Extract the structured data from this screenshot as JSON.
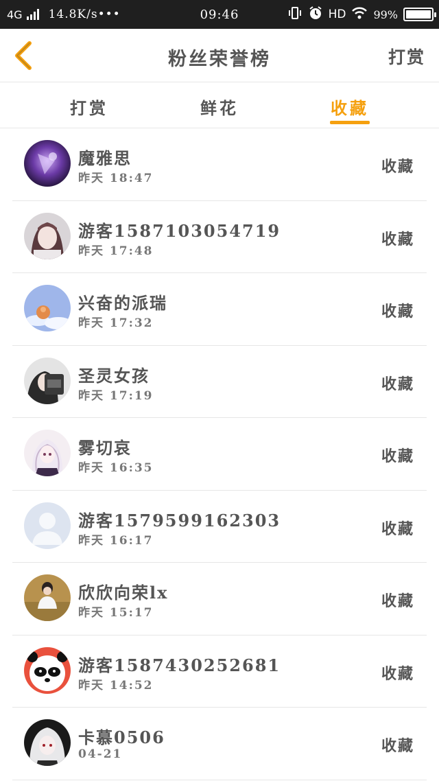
{
  "status_bar": {
    "network": "4G",
    "speed": "14.8K/s•••",
    "time": "09:46",
    "hd": "HD",
    "battery_percent": "99%",
    "battery_level": 0.99
  },
  "header": {
    "title": "粉丝荣誉榜",
    "action_label": "打赏",
    "back_icon": "chevron-left-icon"
  },
  "tabs": [
    {
      "label": "打赏",
      "active": false
    },
    {
      "label": "鲜花",
      "active": false
    },
    {
      "label": "收藏",
      "active": true
    }
  ],
  "colors": {
    "accent": "#f5a00f",
    "status_bar_bg": "#1f1f1f",
    "text": "#555555"
  },
  "fans": [
    {
      "name": "魔雅思",
      "time": "昨天 18:47",
      "action": "收藏",
      "avatar": "purple-anime-avatar"
    },
    {
      "name": "游客1587103054719",
      "time": "昨天 17:48",
      "action": "收藏",
      "avatar": "anime-girl-avatar"
    },
    {
      "name": "兴奋的派瑞",
      "time": "昨天 17:32",
      "action": "收藏",
      "avatar": "sky-avatar"
    },
    {
      "name": "圣灵女孩",
      "time": "昨天 17:19",
      "action": "收藏",
      "avatar": "photo-girl-avatar"
    },
    {
      "name": "雾切哀",
      "time": "昨天 16:35",
      "action": "收藏",
      "avatar": "white-hair-anime-avatar"
    },
    {
      "name": "游客1579599162303",
      "time": "昨天 16:17",
      "action": "收藏",
      "avatar": "default-user-avatar"
    },
    {
      "name": "欣欣向荣lx",
      "time": "昨天 15:17",
      "action": "收藏",
      "avatar": "field-photo-avatar"
    },
    {
      "name": "游客1587430252681",
      "time": "昨天 14:52",
      "action": "收藏",
      "avatar": "panda-avatar"
    },
    {
      "name": "卡慕0506",
      "time": "04-21",
      "action": "收藏",
      "avatar": "dark-anime-avatar"
    }
  ]
}
